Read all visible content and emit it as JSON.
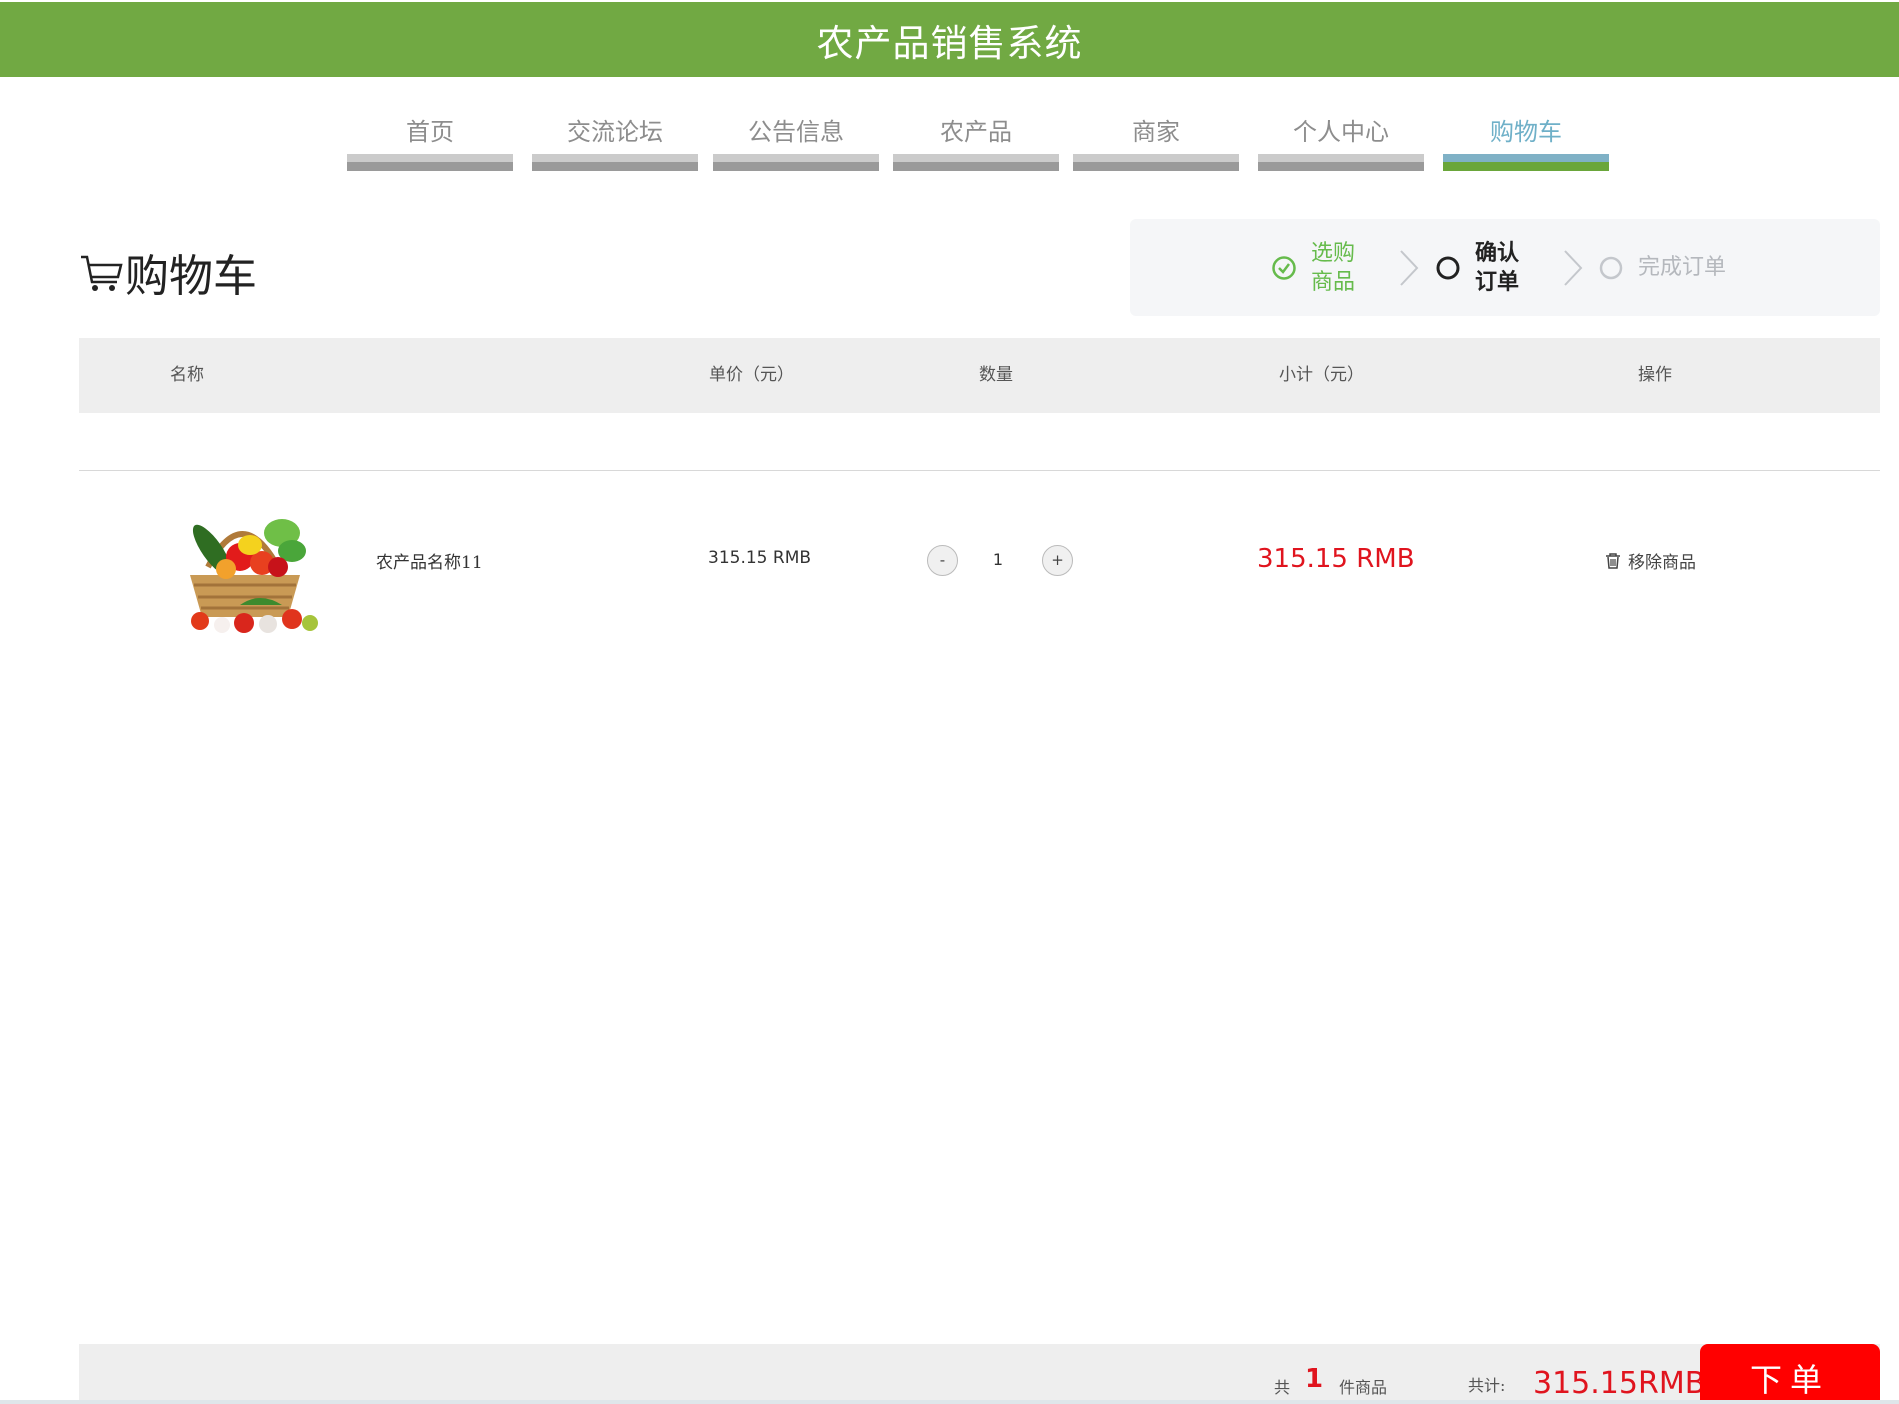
{
  "app": {
    "title": "农产品销售系统"
  },
  "nav": {
    "items": [
      {
        "label": "首页"
      },
      {
        "label": "交流论坛"
      },
      {
        "label": "公告信息"
      },
      {
        "label": "农产品"
      },
      {
        "label": "商家"
      },
      {
        "label": "个人中心"
      },
      {
        "label": "购物车"
      }
    ],
    "active": "购物车"
  },
  "page": {
    "title": "购物车"
  },
  "steps": [
    {
      "label": "选购商品",
      "state": "done"
    },
    {
      "label": "确认订单",
      "state": "current"
    },
    {
      "label": "完成订单",
      "state": "pending"
    }
  ],
  "table": {
    "headers": [
      "名称",
      "单价（元）",
      "数量",
      "小计（元）",
      "操作"
    ],
    "rows": [
      {
        "name": "农产品名称11",
        "unit_price": "315.15 RMB",
        "quantity": "1",
        "qty_minus": "-",
        "qty_plus": "+",
        "subtotal": "315.15 RMB",
        "action": "移除商品"
      }
    ]
  },
  "footer": {
    "count_prefix": "共",
    "count": "1",
    "count_suffix": "件商品",
    "total_label": "共计:",
    "total": "315.15RMB",
    "order_button": "下单"
  },
  "colors": {
    "header_green": "#71a943",
    "active_nav_text": "#6fb0c8",
    "price_red": "#e0141e",
    "order_button": "#ff0000",
    "step_done": "#66bb4c"
  }
}
